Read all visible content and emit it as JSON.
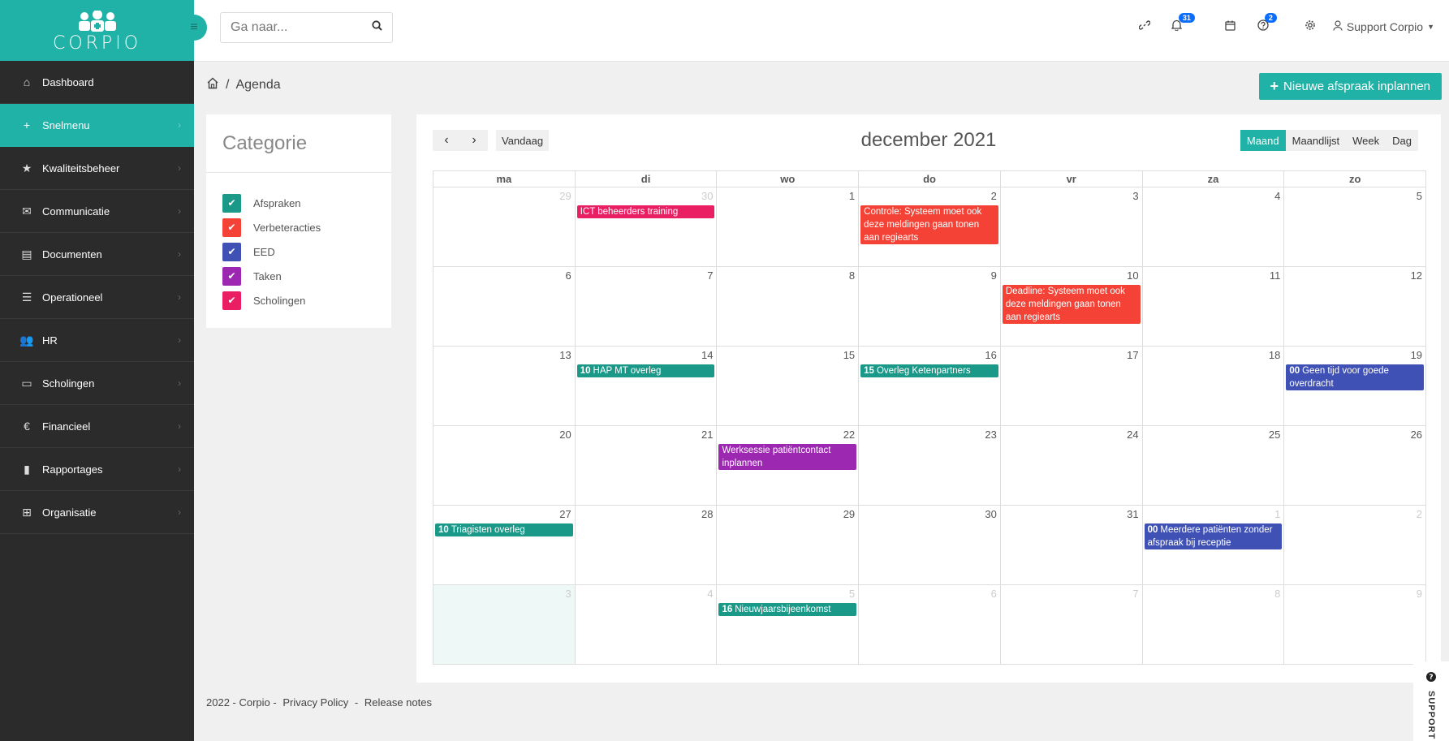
{
  "brand": {
    "name": "CORPIO",
    "accent": "#20b2a6",
    "sidebar_bg": "#2b2b2b"
  },
  "sidebar": {
    "items": [
      {
        "label": "Dashboard",
        "icon": "home-icon",
        "active": false
      },
      {
        "label": "Snelmenu",
        "icon": "plus-icon",
        "active": true
      },
      {
        "label": "Kwaliteitsbeheer",
        "icon": "star-icon",
        "active": false
      },
      {
        "label": "Communicatie",
        "icon": "chat-icon",
        "active": false
      },
      {
        "label": "Documenten",
        "icon": "document-icon",
        "active": false
      },
      {
        "label": "Operationeel",
        "icon": "list-icon",
        "active": false
      },
      {
        "label": "HR",
        "icon": "users-icon",
        "active": false
      },
      {
        "label": "Scholingen",
        "icon": "chalkboard-icon",
        "active": false
      },
      {
        "label": "Financieel",
        "icon": "euro-icon",
        "active": false
      },
      {
        "label": "Rapportages",
        "icon": "chart-icon",
        "active": false
      },
      {
        "label": "Organisatie",
        "icon": "sitemap-icon",
        "active": false
      }
    ]
  },
  "topbar": {
    "search_placeholder": "Ga naar...",
    "notifications_count": "31",
    "help_count": "2",
    "user_name": "Support Corpio"
  },
  "breadcrumb": {
    "page": "Agenda"
  },
  "new_appointment_label": "Nieuwe afspraak inplannen",
  "categories": {
    "title": "Categorie",
    "items": [
      {
        "label": "Afspraken",
        "color": "#1a9888"
      },
      {
        "label": "Verbeteracties",
        "color": "#f44336"
      },
      {
        "label": "EED",
        "color": "#3f51b5"
      },
      {
        "label": "Taken",
        "color": "#9c27b0"
      },
      {
        "label": "Scholingen",
        "color": "#e91e63"
      }
    ]
  },
  "calendar": {
    "title": "december 2021",
    "today_label": "Vandaag",
    "views": [
      "Maand",
      "Maandlijst",
      "Week",
      "Dag"
    ],
    "active_view": "Maand",
    "weekdays": [
      "ma",
      "di",
      "wo",
      "do",
      "vr",
      "za",
      "zo"
    ],
    "weeks": [
      [
        {
          "n": "29",
          "o": true
        },
        {
          "n": "30",
          "o": true
        },
        {
          "n": "1"
        },
        {
          "n": "2"
        },
        {
          "n": "3"
        },
        {
          "n": "4"
        },
        {
          "n": "5"
        }
      ],
      [
        {
          "n": "6"
        },
        {
          "n": "7"
        },
        {
          "n": "8"
        },
        {
          "n": "9"
        },
        {
          "n": "10"
        },
        {
          "n": "11"
        },
        {
          "n": "12"
        }
      ],
      [
        {
          "n": "13"
        },
        {
          "n": "14"
        },
        {
          "n": "15"
        },
        {
          "n": "16"
        },
        {
          "n": "17"
        },
        {
          "n": "18"
        },
        {
          "n": "19"
        }
      ],
      [
        {
          "n": "20"
        },
        {
          "n": "21"
        },
        {
          "n": "22"
        },
        {
          "n": "23"
        },
        {
          "n": "24"
        },
        {
          "n": "25"
        },
        {
          "n": "26"
        }
      ],
      [
        {
          "n": "27"
        },
        {
          "n": "28"
        },
        {
          "n": "29"
        },
        {
          "n": "30"
        },
        {
          "n": "31"
        },
        {
          "n": "1",
          "o": true
        },
        {
          "n": "2",
          "o": true
        }
      ],
      [
        {
          "n": "3",
          "o": true,
          "today": true
        },
        {
          "n": "4",
          "o": true
        },
        {
          "n": "5",
          "o": true
        },
        {
          "n": "6",
          "o": true
        },
        {
          "n": "7",
          "o": true
        },
        {
          "n": "8",
          "o": true
        },
        {
          "n": "9",
          "o": true
        }
      ]
    ],
    "events": [
      {
        "week": 0,
        "day": 1,
        "time": "",
        "title": "ICT beheerders training",
        "category": "Scholingen"
      },
      {
        "week": 0,
        "day": 3,
        "time": "",
        "title": "Controle: Systeem moet ook deze meldingen gaan tonen aan regiearts",
        "category": "Verbeteracties"
      },
      {
        "week": 1,
        "day": 4,
        "time": "",
        "title": "Deadline: Systeem moet ook deze meldingen gaan tonen aan regiearts",
        "category": "Verbeteracties"
      },
      {
        "week": 2,
        "day": 1,
        "time": "10",
        "title": "HAP MT overleg",
        "category": "Afspraken"
      },
      {
        "week": 2,
        "day": 3,
        "time": "15",
        "title": "Overleg Ketenpartners",
        "category": "Afspraken"
      },
      {
        "week": 2,
        "day": 6,
        "time": "00",
        "title": "Geen tijd voor goede overdracht",
        "category": "EED"
      },
      {
        "week": 3,
        "day": 2,
        "time": "",
        "title": "Werksessie patiëntcontact inplannen",
        "category": "Taken"
      },
      {
        "week": 4,
        "day": 0,
        "time": "10",
        "title": "Triagisten overleg",
        "category": "Afspraken"
      },
      {
        "week": 4,
        "day": 5,
        "time": "00",
        "title": "Meerdere patiënten zonder afspraak bij receptie",
        "category": "EED"
      },
      {
        "week": 5,
        "day": 2,
        "time": "16",
        "title": "Nieuwjaarsbijeenkomst",
        "category": "Afspraken"
      }
    ]
  },
  "footer": {
    "copyright": "2022 - Corpio -",
    "privacy": "Privacy Policy",
    "separator": "-",
    "release": "Release notes"
  },
  "support_label": "SUPPORT"
}
